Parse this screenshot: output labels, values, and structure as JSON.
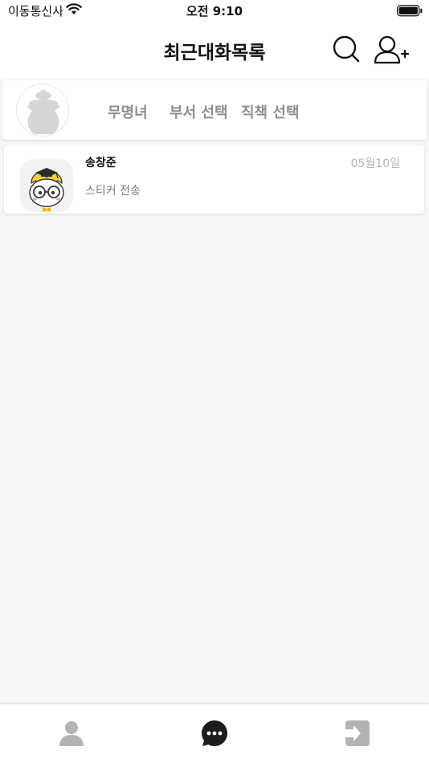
{
  "status_bar": {
    "carrier": "이동통신사",
    "time": "오전 9:10",
    "icons": [
      "wifi-icon",
      "battery-icon"
    ]
  },
  "header": {
    "title": "최근대화목록",
    "icons": [
      "search-icon",
      "add-user-icon"
    ]
  },
  "profile": {
    "name": "무명녀",
    "department": "부서 선택",
    "position": "직책 선택",
    "avatar_icon": "placeholder-avatar-icon"
  },
  "chats": [
    {
      "name": "송창준",
      "date": "05월10일",
      "message": "스티커 전송",
      "avatar_icon": "cartoon-avatar-icon"
    }
  ],
  "tab_bar": {
    "tabs": [
      {
        "icon": "person-icon",
        "active": false
      },
      {
        "icon": "chat-bubble-icon",
        "active": true
      },
      {
        "icon": "logout-icon",
        "active": false
      }
    ]
  },
  "colors": {
    "background": "#f7f7f7",
    "card": "#ffffff",
    "muted_text": "#8e8e8e",
    "date_text": "#b5b5b5",
    "active_tab": "#1c1c1c",
    "inactive_tab": "#b3b3b3"
  }
}
